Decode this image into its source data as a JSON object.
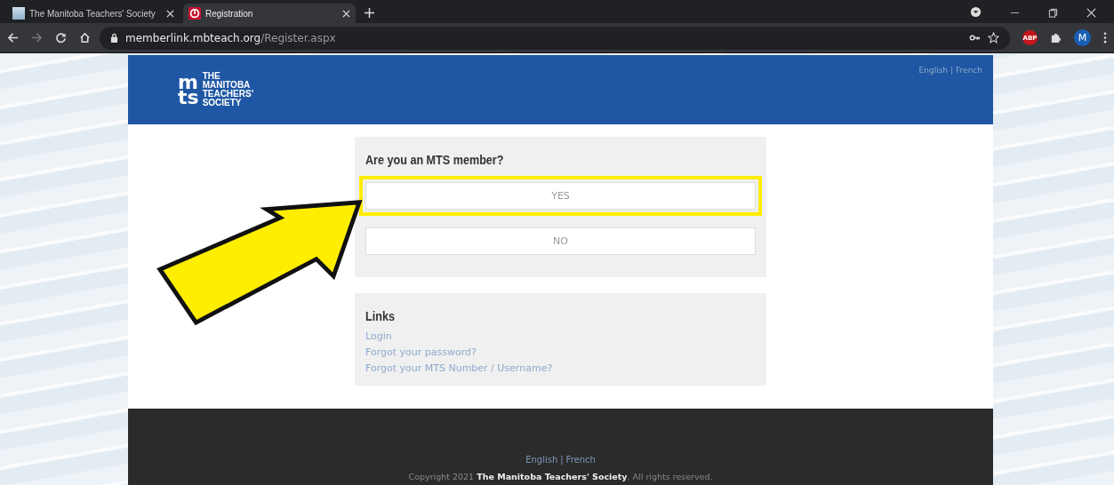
{
  "browser": {
    "tabs": [
      {
        "title": "The Manitoba Teachers' Society",
        "selected": false
      },
      {
        "title": "Registration",
        "selected": true
      }
    ],
    "url": {
      "host": "memberlink.mbteach.org",
      "path": "/Register.aspx"
    },
    "extensions": {
      "adblock": "ABP",
      "profile": "M"
    }
  },
  "header": {
    "logo_mark": [
      "m",
      "ts"
    ],
    "logo_text": [
      "THE",
      "MANITOBA",
      "TEACHERS'",
      "SOCIETY"
    ],
    "languages": [
      "English",
      "French"
    ],
    "separator": "|"
  },
  "member_card": {
    "question": "Are you an MTS member?",
    "options": [
      {
        "label": "YES",
        "highlighted": true
      },
      {
        "label": "NO",
        "highlighted": false
      }
    ]
  },
  "links_card": {
    "title": "Links",
    "links": [
      "Login",
      "Forgot your password?",
      "Forgot your MTS Number / Username?"
    ]
  },
  "footer": {
    "languages": [
      "English",
      "French"
    ],
    "separator": "|",
    "copyright": "Copyright 2021 **The Manitoba Teachers' Society**. All rights reserved."
  },
  "annotation": {
    "kind": "arrow"
  }
}
